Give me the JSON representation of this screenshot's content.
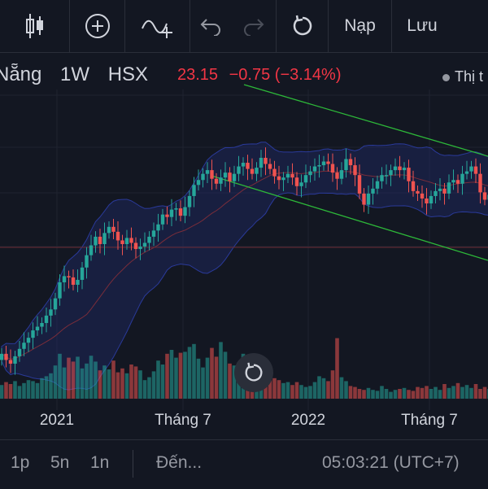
{
  "toolbar": {
    "candles_icon": "candlestick-icon",
    "add_icon": "plus-circle-icon",
    "indicator_icon": "indicator-add-icon",
    "undo_icon": "undo-icon",
    "redo_icon": "redo-icon",
    "reset_icon": "reset-icon",
    "nap_label": "Nạp",
    "luu_label": "Lưu"
  },
  "symbol": {
    "name": "Nẵng",
    "interval": "1W",
    "exchange": "HSX",
    "price": "23.15",
    "change": "−0.75 (−3.14%)"
  },
  "legend": {
    "label": "Thị t"
  },
  "bottom": {
    "range_1p": "1p",
    "range_5n": "5n",
    "range_1n": "1n",
    "goto": "Đến...",
    "clock": "05:03:21 (UTC+7)"
  },
  "colors": {
    "up": "#26a69a",
    "down": "#ef5350",
    "background": "#131722",
    "trend": "#2db839",
    "band": "#1e2a66"
  },
  "chart_data": {
    "type": "candlestick",
    "x_tick_labels": [
      "2021",
      "Tháng 7",
      "2022",
      "Tháng 7"
    ],
    "close": [
      17.0,
      16.5,
      16.2,
      16.8,
      17.4,
      17.9,
      18.3,
      18.9,
      19.2,
      19.5,
      20.1,
      20.6,
      21.5,
      22.8,
      23.3,
      23.2,
      22.6,
      23.0,
      24.0,
      25.0,
      25.8,
      26.5,
      25.9,
      26.8,
      27.3,
      26.9,
      26.2,
      25.9,
      26.4,
      26.0,
      25.5,
      25.7,
      26.0,
      26.5,
      27.0,
      27.5,
      28.3,
      28.1,
      28.7,
      28.8,
      28.2,
      28.9,
      29.8,
      30.7,
      31.1,
      31.6,
      31.9,
      31.2,
      30.8,
      31.3,
      31.7,
      31.0,
      31.6,
      32.2,
      32.5,
      32.0,
      31.6,
      32.1,
      32.9,
      32.4,
      32.0,
      31.4,
      31.1,
      31.3,
      31.6,
      31.3,
      30.6,
      30.9,
      31.5,
      31.8,
      32.2,
      32.3,
      32.6,
      32.4,
      31.7,
      31.2,
      31.9,
      32.8,
      32.3,
      31.5,
      30.0,
      29.1,
      30.0,
      30.4,
      31.0,
      31.5,
      31.5,
      31.9,
      32.2,
      31.9,
      32.1,
      31.0,
      30.2,
      30.0,
      29.6,
      29.2,
      29.8,
      30.2,
      30.4,
      30.0,
      30.9,
      31.1,
      30.8,
      31.6,
      31.8,
      32.2,
      31.6,
      30.1,
      29.5,
      29.9
    ],
    "volume": [
      1.4,
      1.7,
      1.5,
      1.8,
      1.3,
      1.6,
      1.9,
      1.8,
      1.6,
      2.1,
      2.3,
      2.6,
      3.4,
      4.6,
      3.2,
      4.2,
      3.8,
      4.3,
      3.1,
      3.6,
      4.4,
      3.8,
      2.9,
      3.4,
      3.0,
      3.9,
      2.7,
      3.1,
      2.6,
      3.5,
      3.3,
      2.9,
      1.9,
      2.2,
      2.8,
      3.9,
      3.5,
      4.6,
      5.0,
      4.2,
      4.7,
      4.8,
      5.3,
      5.6,
      4.1,
      3.2,
      4.2,
      5.2,
      4.3,
      5.8,
      4.8,
      3.6,
      3.4,
      3.7,
      4.6,
      4.0,
      2.6,
      2.3,
      2.2,
      1.9,
      2.1,
      2.1,
      1.9,
      1.6,
      1.7,
      1.4,
      1.7,
      1.4,
      1.2,
      1.3,
      1.7,
      2.3,
      2.1,
      1.8,
      2.9,
      6.2,
      2.2,
      1.8,
      1.3,
      1.2,
      1.0,
      0.9,
      1.1,
      0.9,
      0.8,
      1.3,
      1.0,
      0.7,
      0.9,
      1.0,
      1.1,
      0.9,
      0.8,
      1.2,
      1.1,
      1.3,
      1.0,
      1.2,
      0.9,
      1.5,
      1.1,
      1.3,
      1.6,
      1.2,
      1.4,
      1.1,
      1.5,
      1.0,
      1.2,
      1.0
    ],
    "grid": true
  }
}
